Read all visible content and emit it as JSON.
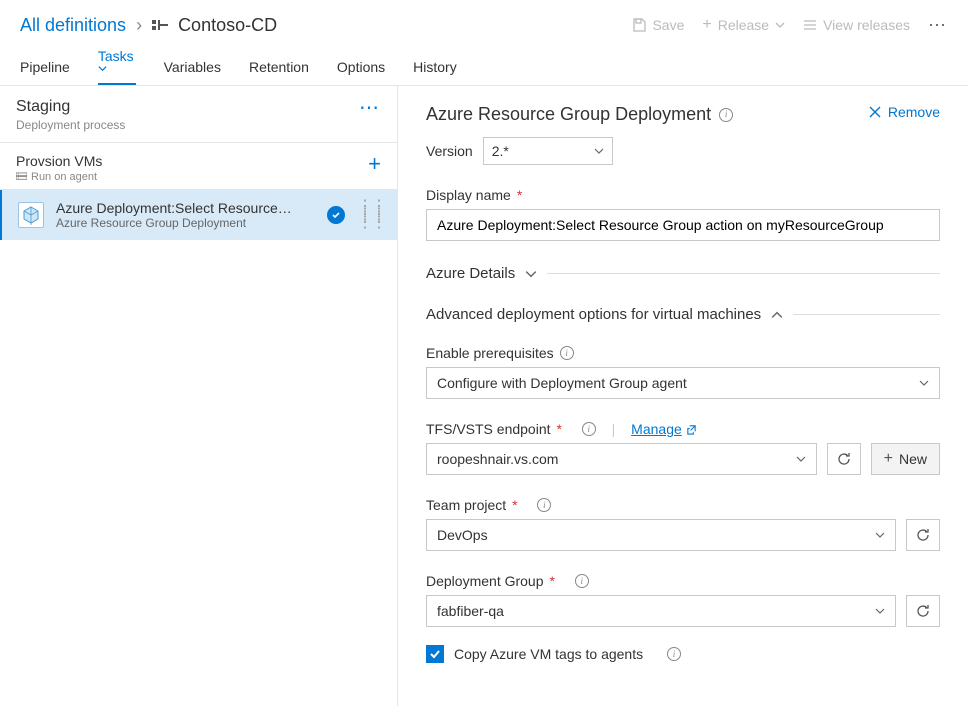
{
  "breadcrumb": {
    "root": "All definitions",
    "sep": "›",
    "name": "Contoso-CD"
  },
  "topActions": {
    "save": "Save",
    "release": "Release",
    "viewReleases": "View releases"
  },
  "tabs": [
    "Pipeline",
    "Tasks",
    "Variables",
    "Retention",
    "Options",
    "History"
  ],
  "stage": {
    "title": "Staging",
    "subtitle": "Deployment process"
  },
  "agent": {
    "title": "Provsion VMs",
    "subtitle": "Run on agent"
  },
  "task": {
    "title": "Azure Deployment:Select Resource…",
    "subtitle": "Azure Resource Group Deployment"
  },
  "form": {
    "title": "Azure Resource Group Deployment",
    "remove": "Remove",
    "versionLabel": "Version",
    "versionValue": "2.*",
    "displayNameLabel": "Display name",
    "displayNameValue": "Azure Deployment:Select Resource Group action on myResourceGroup",
    "azureDetails": "Azure Details",
    "advSection": "Advanced deployment options for virtual machines",
    "enablePrereqLabel": "Enable prerequisites",
    "enablePrereqValue": "Configure with Deployment Group agent",
    "endpointLabel": "TFS/VSTS endpoint",
    "manage": "Manage",
    "endpointValue": "roopeshnair.vs.com",
    "newBtn": "New",
    "teamProjectLabel": "Team project",
    "teamProjectValue": "DevOps",
    "deployGroupLabel": "Deployment Group",
    "deployGroupValue": "fabfiber-qa",
    "copyTags": "Copy Azure VM tags to agents"
  }
}
